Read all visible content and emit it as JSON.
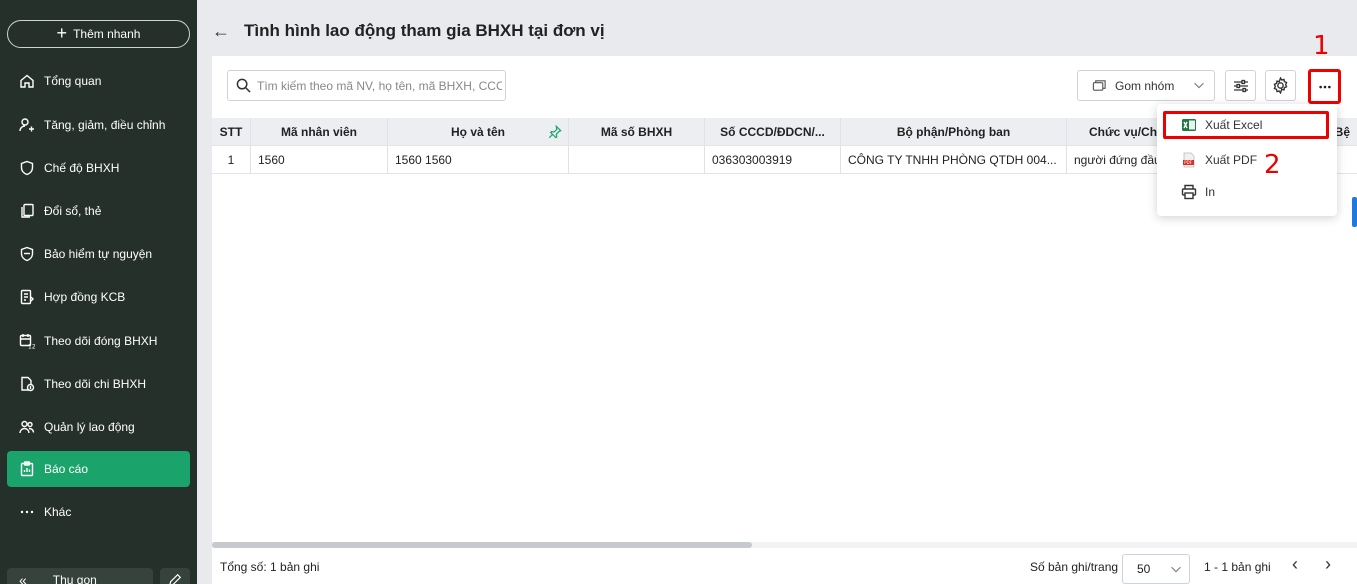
{
  "sidebar": {
    "quick_add": "Thêm nhanh",
    "items": [
      {
        "label": "Tổng quan",
        "icon": "home-icon"
      },
      {
        "label": "Tăng, giảm, điều chỉnh",
        "icon": "user-adjust-icon"
      },
      {
        "label": "Chế độ BHXH",
        "icon": "shield-icon"
      },
      {
        "label": "Đổi sổ, thẻ",
        "icon": "card-swap-icon"
      },
      {
        "label": "Bảo hiểm tự nguyện",
        "icon": "shield-heart-icon"
      },
      {
        "label": "Hợp đồng KCB",
        "icon": "contract-icon"
      },
      {
        "label": "Theo dõi đóng BHXH",
        "icon": "calendar-icon"
      },
      {
        "label": "Theo dõi chi BHXH",
        "icon": "document-money-icon"
      },
      {
        "label": "Quản lý lao động",
        "icon": "people-icon"
      },
      {
        "label": "Báo cáo",
        "icon": "report-icon",
        "active": true
      },
      {
        "label": "Khác",
        "icon": "more-horizontal-icon"
      }
    ],
    "collapse_label": "Thu gọn"
  },
  "header": {
    "title": "Tình hình lao động tham gia BHXH tại đơn vị"
  },
  "toolbar": {
    "search_placeholder": "Tìm kiếm theo mã NV, họ tên, mã BHXH, CCC...",
    "group_label": "Gom nhóm"
  },
  "table": {
    "columns": [
      "STT",
      "Mã nhân viên",
      "Họ và tên",
      "Mã số BHXH",
      "Số CCCD/ĐDCN/...",
      "Bộ phận/Phòng ban",
      "Chức vụ/Chức",
      "Bệ"
    ],
    "rows": [
      [
        "1",
        "1560",
        "1560 1560",
        "",
        "036303003919",
        "CÔNG TY TNHH PHÒNG QTDH 004...",
        "người đứng đầu",
        ""
      ]
    ]
  },
  "menu": {
    "items": [
      {
        "label": "Xuất Excel",
        "icon": "excel-icon"
      },
      {
        "label": "Xuất PDF",
        "icon": "pdf-icon"
      },
      {
        "label": "In",
        "icon": "printer-icon"
      }
    ]
  },
  "footer": {
    "total": "Tổng số: 1 bản ghi",
    "per_page_label": "Số bản ghi/trang",
    "per_page_value": "50",
    "range": "1 - 1 bản ghi"
  },
  "annotations": {
    "step1": "1",
    "step2": "2"
  },
  "colors": {
    "sidebar_bg": "#25302b",
    "active_green": "#1aa36b",
    "highlight_red": "#e00000"
  }
}
